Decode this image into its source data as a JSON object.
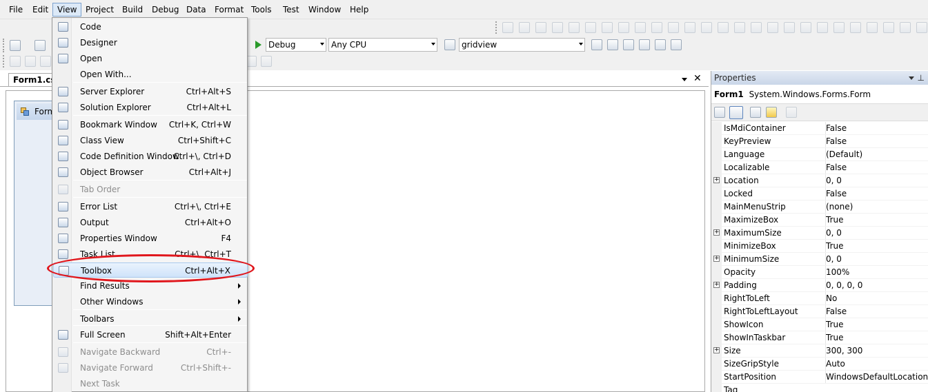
{
  "menubar": {
    "items": [
      {
        "label": "File"
      },
      {
        "label": "Edit"
      },
      {
        "label": "View",
        "active": true
      },
      {
        "label": "Project"
      },
      {
        "label": "Build"
      },
      {
        "label": "Debug"
      },
      {
        "label": "Data"
      },
      {
        "label": "Format"
      },
      {
        "label": "Tools"
      },
      {
        "label": "Test"
      },
      {
        "label": "Window"
      },
      {
        "label": "Help"
      }
    ]
  },
  "toolbar": {
    "config": "Debug",
    "platform": "Any CPU",
    "find_box": "gridview"
  },
  "document": {
    "tab_label": "Form1.cs [",
    "form_title": "Form"
  },
  "view_menu": {
    "items": [
      {
        "label": "Code",
        "shortcut": "",
        "icon": "code-icon"
      },
      {
        "label": "Designer",
        "shortcut": "",
        "icon": "designer-icon"
      },
      {
        "label": "Open",
        "shortcut": "",
        "icon": "open-icon"
      },
      {
        "label": "Open With...",
        "shortcut": ""
      },
      {
        "label": "Server Explorer",
        "shortcut": "Ctrl+Alt+S",
        "icon": "server-explorer-icon"
      },
      {
        "label": "Solution Explorer",
        "shortcut": "Ctrl+Alt+L",
        "icon": "solution-explorer-icon"
      },
      {
        "label": "Bookmark Window",
        "shortcut": "Ctrl+K, Ctrl+W",
        "icon": "bookmark-icon"
      },
      {
        "label": "Class View",
        "shortcut": "Ctrl+Shift+C",
        "icon": "class-view-icon"
      },
      {
        "label": "Code Definition Window",
        "shortcut": "Ctrl+\\, Ctrl+D",
        "icon": "code-definition-icon"
      },
      {
        "label": "Object Browser",
        "shortcut": "Ctrl+Alt+J",
        "icon": "object-browser-icon"
      },
      {
        "label": "Tab Order",
        "shortcut": "",
        "icon": "tab-order-icon",
        "disabled": true
      },
      {
        "label": "Error List",
        "shortcut": "Ctrl+\\, Ctrl+E",
        "icon": "error-list-icon"
      },
      {
        "label": "Output",
        "shortcut": "Ctrl+Alt+O",
        "icon": "output-icon"
      },
      {
        "label": "Properties Window",
        "shortcut": "F4",
        "icon": "properties-icon"
      },
      {
        "label": "Task List",
        "shortcut": "Ctrl+\\, Ctrl+T",
        "icon": "task-list-icon"
      },
      {
        "label": "Toolbox",
        "shortcut": "Ctrl+Alt+X",
        "icon": "toolbox-icon",
        "highlighted": true
      },
      {
        "label": "Find Results",
        "shortcut": "",
        "submenu": true
      },
      {
        "label": "Other Windows",
        "shortcut": "",
        "submenu": true
      },
      {
        "label": "Toolbars",
        "shortcut": "",
        "submenu": true
      },
      {
        "label": "Full Screen",
        "shortcut": "Shift+Alt+Enter",
        "icon": "full-screen-icon"
      },
      {
        "label": "Navigate Backward",
        "shortcut": "Ctrl+-",
        "icon": "navigate-backward-icon",
        "disabled": true
      },
      {
        "label": "Navigate Forward",
        "shortcut": "Ctrl+Shift+-",
        "icon": "navigate-forward-icon",
        "disabled": true
      },
      {
        "label": "Next Task",
        "shortcut": "",
        "disabled": true
      }
    ]
  },
  "properties": {
    "title": "Properties",
    "object_name": "Form1",
    "object_type": "System.Windows.Forms.Form",
    "rows": [
      {
        "name": "IsMdiContainer",
        "value": "False"
      },
      {
        "name": "KeyPreview",
        "value": "False"
      },
      {
        "name": "Language",
        "value": "(Default)"
      },
      {
        "name": "Localizable",
        "value": "False"
      },
      {
        "name": "Location",
        "value": "0, 0",
        "expandable": true
      },
      {
        "name": "Locked",
        "value": "False"
      },
      {
        "name": "MainMenuStrip",
        "value": "(none)"
      },
      {
        "name": "MaximizeBox",
        "value": "True"
      },
      {
        "name": "MaximumSize",
        "value": "0, 0",
        "expandable": true
      },
      {
        "name": "MinimizeBox",
        "value": "True"
      },
      {
        "name": "MinimumSize",
        "value": "0, 0",
        "expandable": true
      },
      {
        "name": "Opacity",
        "value": "100%"
      },
      {
        "name": "Padding",
        "value": "0, 0, 0, 0",
        "expandable": true
      },
      {
        "name": "RightToLeft",
        "value": "No"
      },
      {
        "name": "RightToLeftLayout",
        "value": "False"
      },
      {
        "name": "ShowIcon",
        "value": "True"
      },
      {
        "name": "ShowInTaskbar",
        "value": "True"
      },
      {
        "name": "Size",
        "value": "300, 300",
        "expandable": true
      },
      {
        "name": "SizeGripStyle",
        "value": "Auto"
      },
      {
        "name": "StartPosition",
        "value": "WindowsDefaultLocation"
      },
      {
        "name": "Tag",
        "value": ""
      }
    ]
  },
  "colors": {
    "annotation": "#e0161c",
    "highlight": "#cfe3fa"
  }
}
